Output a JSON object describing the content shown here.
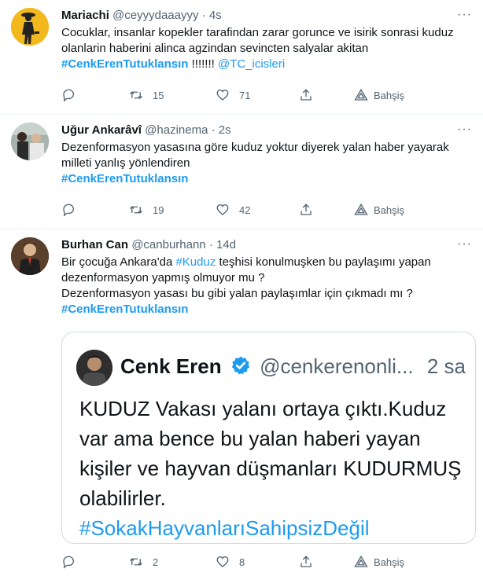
{
  "tweets": [
    {
      "name": "Mariachi",
      "handle": "@ceyyydaaayyy",
      "dot": "·",
      "time": "4s",
      "text1": "Cocuklar, insanlar kopekler tarafindan zarar gorunce ve isirik sonrasi kuduz olanlarin haberini alinca agzindan sevincten salyalar akitan",
      "hashtag": "#CenkErenTutuklansın",
      "bangs": " !!!!!!! ",
      "mention": "@TC_icisleri",
      "retweets": "15",
      "likes": "71",
      "tip": "Bahşiş"
    },
    {
      "name": "Uğur Ankarâvî",
      "handle": "@hazinema",
      "dot": "·",
      "time": "2s",
      "text1": "Dezenformasyon yasasına göre kuduz yoktur diyerek yalan haber yayarak milleti yanlış yönlendiren",
      "hashtag": "#CenkErenTutuklansın",
      "retweets": "19",
      "likes": "42",
      "tip": "Bahşiş"
    },
    {
      "name": "Burhan Can",
      "handle": "@canburhann",
      "dot": "·",
      "time": "14d",
      "text_a": "Bir çocuğa Ankara'da ",
      "inline_hashtag": "#Kuduz",
      "text_b": " teşhisi konulmuşken bu paylaşımı yapan dezenformasyon yapmış olmuyor mu ?",
      "text_c": "Dezenformasyon yasası bu gibi yalan paylaşımlar için çıkmadı mı ?",
      "hashtag": "#CenkErenTutuklansın",
      "retweets": "2",
      "likes": "8",
      "tip": "Bahşiş",
      "quote": {
        "name": "Cenk Eren",
        "handle": "@cenkerenonli...",
        "time": "2 sa",
        "text": "KUDUZ Vakası yalanı ortaya çıktı.Kuduz var ama bence bu yalan haberi yayan kişiler ve hayvan düşmanları KUDURMUŞ olabilirler.",
        "hashtag": "#SokakHayvanlarıSahipsizDeğil"
      }
    }
  ],
  "more_label": "···",
  "colors": {
    "accent": "#1d9bf0",
    "muted": "#536471",
    "text": "#0f1419",
    "border": "#eff3f4"
  }
}
